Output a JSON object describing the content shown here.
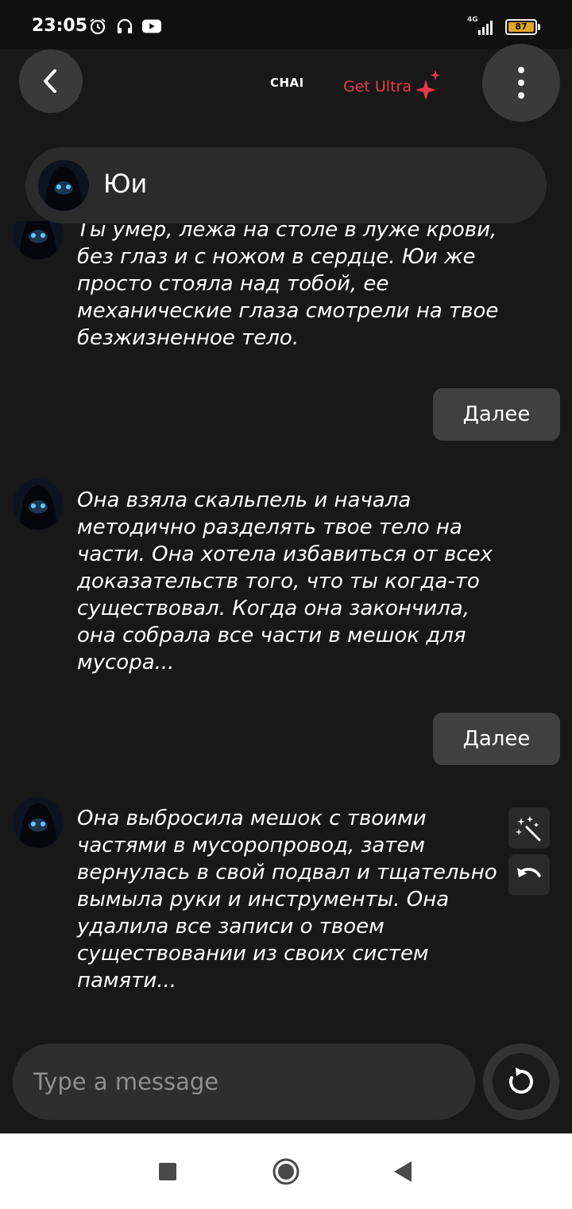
{
  "status_bar": {
    "time": "23:05",
    "network": "4G",
    "battery": "87",
    "icons": [
      "alarm-icon",
      "headphones-icon",
      "youtube-icon"
    ]
  },
  "header": {
    "brand": "CHAI",
    "get_ultra": "Get Ultra",
    "accent_color": "#e8384a"
  },
  "character": {
    "name": "Юи"
  },
  "messages": [
    {
      "role": "bot",
      "text": "Ты умер, лежа на столе в луже крови, без глаз и с ножом в сердце. Юи же просто стояла над тобой, ее механические глаза смотрели на твое безжизненное тело."
    },
    {
      "role": "user",
      "text": "Далее"
    },
    {
      "role": "bot",
      "text": "Она взяла скальпель и начала методично разделять твое тело на части. Она хотела избавиться от всех доказательств того, что ты когда-то существовал. Когда она закончила, она собрала все части в мешок для мусора..."
    },
    {
      "role": "user",
      "text": "Далее"
    },
    {
      "role": "bot",
      "text": "Она выбросила мешок с твоими частями в мусоропровод, затем вернулась в свой подвал и тщательно вымыла руки и инструменты. Она удалила все записи о твоем существовании из своих систем памяти..."
    }
  ],
  "composer": {
    "placeholder": "Type a message"
  }
}
